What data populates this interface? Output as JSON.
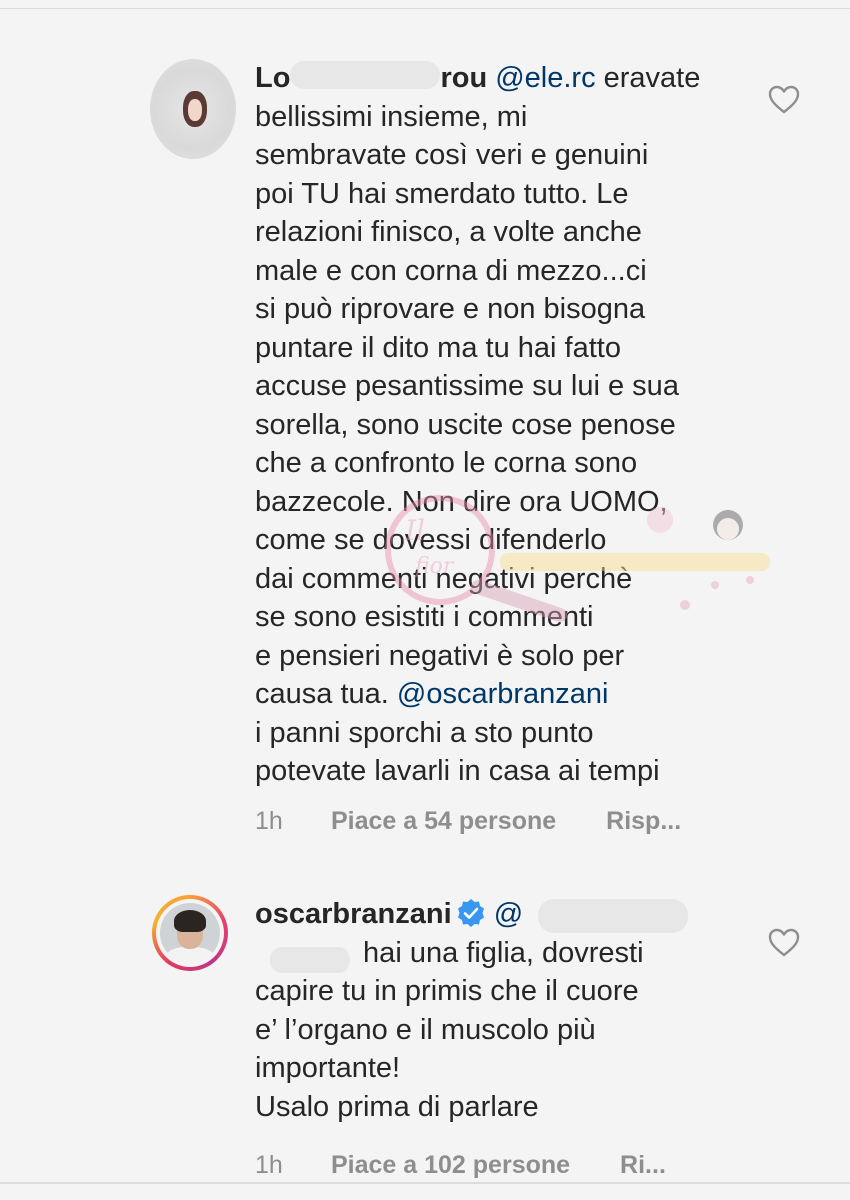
{
  "comments": [
    {
      "username_visible": "Lo",
      "username_suffix": "rou",
      "mention": "@ele.rc",
      "text_after_mention": " eravate\nbellissimi insieme, mi\nsembravate così veri e genuini\npoi TU hai smerdato tutto. Le\nrelazioni finisco, a volte anche\nmale e con corna di mezzo...ci\nsi può riprovare e non bisogna\npuntare il dito ma tu hai fatto\naccuse pesantissime su lui e sua\nsorella, sono uscite cose penose\nche a confronto le corna sono\nbazzecole. Non dire ora UOMO,\ncome se dovessi difenderlo\ndai commenti negativi perchè\nse sono esistiti i commenti\ne pensieri negativi è solo per\ncausa tua. ",
      "mention2": "@oscarbranzani",
      "text_end": "\ni panni sporchi a sto punto\npotevate lavarli in casa ai tempi",
      "time": "1h",
      "likes": "Piace a 54 persone",
      "reply": "Risp..."
    },
    {
      "username": "oscarbranzani",
      "mention_start": "@",
      "line1": " hai una figlia, dovresti",
      "text": "capire tu in primis che il cuore\ne’ l’organo e il muscolo più\nimportante!\nUsalo prima di parlare",
      "time": "1h",
      "likes": "Piace a 102 persone",
      "reply": "Ri..."
    }
  ],
  "icons": {
    "heart": "heart-icon",
    "verified": "verified-badge-icon"
  },
  "colors": {
    "text": "#262626",
    "mention": "#00376b",
    "meta": "#8e8e8e",
    "verified": "#3897f0"
  }
}
